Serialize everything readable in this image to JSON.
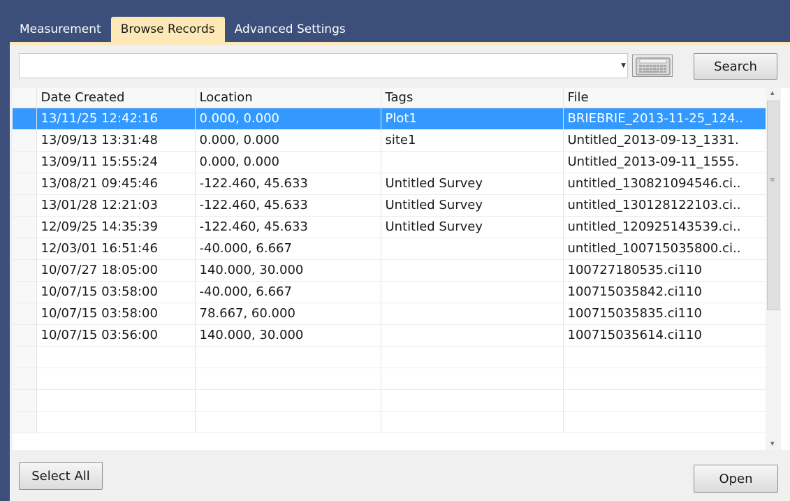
{
  "tabs": [
    {
      "label": "Measurement",
      "active": false
    },
    {
      "label": "Browse Records",
      "active": true
    },
    {
      "label": "Advanced Settings",
      "active": false
    }
  ],
  "search": {
    "value": "",
    "button_label": "Search",
    "dropdown_icon": "chevron-down-icon",
    "keyboard_icon": "keyboard-icon"
  },
  "table": {
    "columns": [
      "Date Created",
      "Location",
      "Tags",
      "File"
    ],
    "rows": [
      [
        "13/11/25 12:42:16",
        "0.000, 0.000",
        "Plot1",
        "BRIEBRIE_2013-11-25_124.."
      ],
      [
        "13/09/13 13:31:48",
        "0.000, 0.000",
        "site1",
        "Untitled_2013-09-13_1331."
      ],
      [
        "13/09/11 15:55:24",
        "0.000, 0.000",
        "",
        "Untitled_2013-09-11_1555."
      ],
      [
        "13/08/21 09:45:46",
        "-122.460, 45.633",
        "Untitled Survey",
        "untitled_130821094546.ci.."
      ],
      [
        "13/01/28 12:21:03",
        "-122.460, 45.633",
        "Untitled Survey",
        "untitled_130128122103.ci.."
      ],
      [
        "12/09/25 14:35:39",
        "-122.460, 45.633",
        "Untitled Survey",
        "untitled_120925143539.ci.."
      ],
      [
        "12/03/01 16:51:46",
        "-40.000, 6.667",
        "",
        "untitled_100715035800.ci.."
      ],
      [
        "10/07/27 18:05:00",
        "140.000, 30.000",
        "",
        "100727180535.ci110"
      ],
      [
        "10/07/15 03:58:00",
        "-40.000, 6.667",
        "",
        "100715035842.ci110"
      ],
      [
        "10/07/15 03:58:00",
        "78.667, 60.000",
        "",
        "100715035835.ci110"
      ],
      [
        "10/07/15 03:56:00",
        "140.000, 30.000",
        "",
        "100715035614.ci110"
      ]
    ],
    "selected_row": 0,
    "empty_rows": 4
  },
  "footer": {
    "select_all_label": "Select All",
    "open_label": "Open"
  },
  "colors": {
    "frame": "#3b4f7a",
    "active_tab": "#fde8b6",
    "selection": "#3399ff"
  }
}
